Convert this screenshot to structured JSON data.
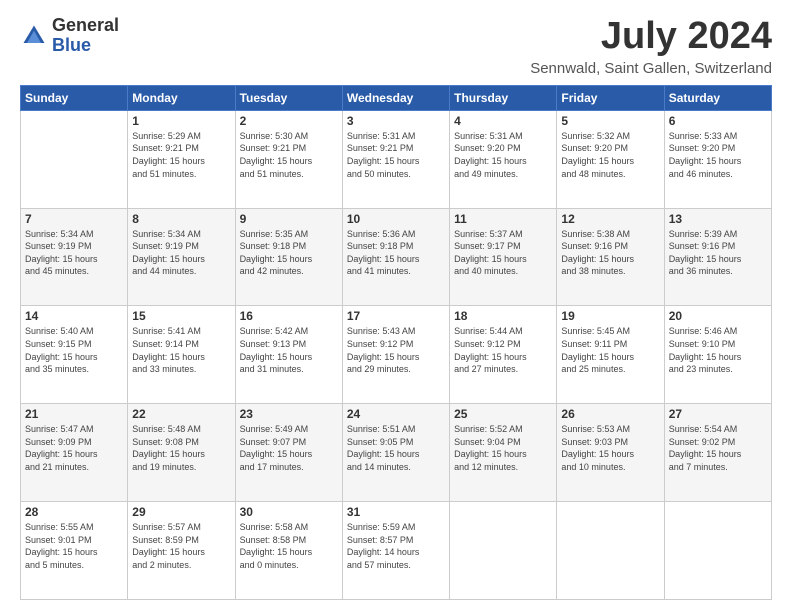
{
  "header": {
    "logo": {
      "general": "General",
      "blue": "Blue",
      "icon_title": "GeneralBlue logo"
    },
    "title": "July 2024",
    "location": "Sennwald, Saint Gallen, Switzerland"
  },
  "calendar": {
    "days_of_week": [
      "Sunday",
      "Monday",
      "Tuesday",
      "Wednesday",
      "Thursday",
      "Friday",
      "Saturday"
    ],
    "weeks": [
      [
        {
          "day": "",
          "info": ""
        },
        {
          "day": "1",
          "info": "Sunrise: 5:29 AM\nSunset: 9:21 PM\nDaylight: 15 hours\nand 51 minutes."
        },
        {
          "day": "2",
          "info": "Sunrise: 5:30 AM\nSunset: 9:21 PM\nDaylight: 15 hours\nand 51 minutes."
        },
        {
          "day": "3",
          "info": "Sunrise: 5:31 AM\nSunset: 9:21 PM\nDaylight: 15 hours\nand 50 minutes."
        },
        {
          "day": "4",
          "info": "Sunrise: 5:31 AM\nSunset: 9:20 PM\nDaylight: 15 hours\nand 49 minutes."
        },
        {
          "day": "5",
          "info": "Sunrise: 5:32 AM\nSunset: 9:20 PM\nDaylight: 15 hours\nand 48 minutes."
        },
        {
          "day": "6",
          "info": "Sunrise: 5:33 AM\nSunset: 9:20 PM\nDaylight: 15 hours\nand 46 minutes."
        }
      ],
      [
        {
          "day": "7",
          "info": "Sunrise: 5:34 AM\nSunset: 9:19 PM\nDaylight: 15 hours\nand 45 minutes."
        },
        {
          "day": "8",
          "info": "Sunrise: 5:34 AM\nSunset: 9:19 PM\nDaylight: 15 hours\nand 44 minutes."
        },
        {
          "day": "9",
          "info": "Sunrise: 5:35 AM\nSunset: 9:18 PM\nDaylight: 15 hours\nand 42 minutes."
        },
        {
          "day": "10",
          "info": "Sunrise: 5:36 AM\nSunset: 9:18 PM\nDaylight: 15 hours\nand 41 minutes."
        },
        {
          "day": "11",
          "info": "Sunrise: 5:37 AM\nSunset: 9:17 PM\nDaylight: 15 hours\nand 40 minutes."
        },
        {
          "day": "12",
          "info": "Sunrise: 5:38 AM\nSunset: 9:16 PM\nDaylight: 15 hours\nand 38 minutes."
        },
        {
          "day": "13",
          "info": "Sunrise: 5:39 AM\nSunset: 9:16 PM\nDaylight: 15 hours\nand 36 minutes."
        }
      ],
      [
        {
          "day": "14",
          "info": "Sunrise: 5:40 AM\nSunset: 9:15 PM\nDaylight: 15 hours\nand 35 minutes."
        },
        {
          "day": "15",
          "info": "Sunrise: 5:41 AM\nSunset: 9:14 PM\nDaylight: 15 hours\nand 33 minutes."
        },
        {
          "day": "16",
          "info": "Sunrise: 5:42 AM\nSunset: 9:13 PM\nDaylight: 15 hours\nand 31 minutes."
        },
        {
          "day": "17",
          "info": "Sunrise: 5:43 AM\nSunset: 9:12 PM\nDaylight: 15 hours\nand 29 minutes."
        },
        {
          "day": "18",
          "info": "Sunrise: 5:44 AM\nSunset: 9:12 PM\nDaylight: 15 hours\nand 27 minutes."
        },
        {
          "day": "19",
          "info": "Sunrise: 5:45 AM\nSunset: 9:11 PM\nDaylight: 15 hours\nand 25 minutes."
        },
        {
          "day": "20",
          "info": "Sunrise: 5:46 AM\nSunset: 9:10 PM\nDaylight: 15 hours\nand 23 minutes."
        }
      ],
      [
        {
          "day": "21",
          "info": "Sunrise: 5:47 AM\nSunset: 9:09 PM\nDaylight: 15 hours\nand 21 minutes."
        },
        {
          "day": "22",
          "info": "Sunrise: 5:48 AM\nSunset: 9:08 PM\nDaylight: 15 hours\nand 19 minutes."
        },
        {
          "day": "23",
          "info": "Sunrise: 5:49 AM\nSunset: 9:07 PM\nDaylight: 15 hours\nand 17 minutes."
        },
        {
          "day": "24",
          "info": "Sunrise: 5:51 AM\nSunset: 9:05 PM\nDaylight: 15 hours\nand 14 minutes."
        },
        {
          "day": "25",
          "info": "Sunrise: 5:52 AM\nSunset: 9:04 PM\nDaylight: 15 hours\nand 12 minutes."
        },
        {
          "day": "26",
          "info": "Sunrise: 5:53 AM\nSunset: 9:03 PM\nDaylight: 15 hours\nand 10 minutes."
        },
        {
          "day": "27",
          "info": "Sunrise: 5:54 AM\nSunset: 9:02 PM\nDaylight: 15 hours\nand 7 minutes."
        }
      ],
      [
        {
          "day": "28",
          "info": "Sunrise: 5:55 AM\nSunset: 9:01 PM\nDaylight: 15 hours\nand 5 minutes."
        },
        {
          "day": "29",
          "info": "Sunrise: 5:57 AM\nSunset: 8:59 PM\nDaylight: 15 hours\nand 2 minutes."
        },
        {
          "day": "30",
          "info": "Sunrise: 5:58 AM\nSunset: 8:58 PM\nDaylight: 15 hours\nand 0 minutes."
        },
        {
          "day": "31",
          "info": "Sunrise: 5:59 AM\nSunset: 8:57 PM\nDaylight: 14 hours\nand 57 minutes."
        },
        {
          "day": "",
          "info": ""
        },
        {
          "day": "",
          "info": ""
        },
        {
          "day": "",
          "info": ""
        }
      ]
    ]
  }
}
